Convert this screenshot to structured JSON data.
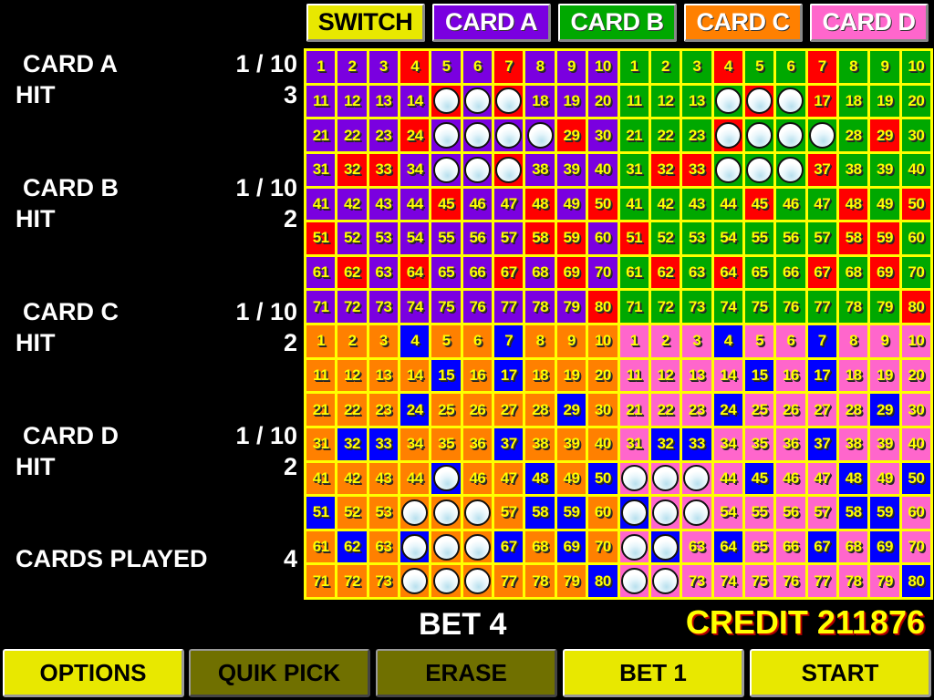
{
  "colors": {
    "card_a": "#7a00e0",
    "card_b": "#00a800",
    "card_c": "#ff8000",
    "card_d": "#ff66cc",
    "drawn_top": "#ff0000",
    "drawn_bottom": "#0000ff",
    "switch": "#e8e800",
    "button_active": "#e8e800",
    "button_disabled": "#707000"
  },
  "tabs": [
    {
      "label": "SWITCH",
      "color": "#e8e800",
      "text": "dark"
    },
    {
      "label": "CARD A",
      "color": "#7a00e0",
      "text": "white"
    },
    {
      "label": "CARD B",
      "color": "#00a800",
      "text": "white"
    },
    {
      "label": "CARD C",
      "color": "#ff8000",
      "text": "white"
    },
    {
      "label": "CARD D",
      "color": "#ff66cc",
      "text": "white"
    }
  ],
  "cards": [
    {
      "name": "CARD A",
      "spots": "1 / 10",
      "hit_label": "HIT",
      "hits": "3",
      "color": "#7a00e0",
      "drawn_color": "#ff0000",
      "picks": [
        15,
        16,
        17,
        25,
        26,
        27,
        28,
        35,
        36,
        37
      ]
    },
    {
      "name": "CARD B",
      "spots": "1 / 10",
      "hit_label": "HIT",
      "hits": "2",
      "color": "#00a800",
      "drawn_color": "#ff0000",
      "picks": [
        14,
        15,
        16,
        24,
        25,
        26,
        27,
        34,
        35,
        36
      ]
    },
    {
      "name": "CARD C",
      "spots": "1 / 10",
      "hit_label": "HIT",
      "hits": "2",
      "color": "#ff8000",
      "drawn_color": "#0000ff",
      "picks": [
        45,
        54,
        55,
        56,
        64,
        65,
        66,
        74,
        75,
        76
      ]
    },
    {
      "name": "CARD D",
      "spots": "1 / 10",
      "hit_label": "HIT",
      "hits": "2",
      "color": "#ff66cc",
      "drawn_color": "#0000ff",
      "picks": [
        41,
        42,
        43,
        51,
        52,
        53,
        61,
        62,
        71,
        72
      ]
    }
  ],
  "drawn_numbers": [
    4,
    7,
    15,
    17,
    24,
    29,
    32,
    33,
    37,
    45,
    48,
    50,
    51,
    58,
    59,
    62,
    64,
    67,
    69,
    80
  ],
  "cards_played": {
    "label": "CARDS PLAYED",
    "value": "4"
  },
  "bet": "BET 4",
  "credit": "CREDIT 211876",
  "buttons": [
    {
      "label": "OPTIONS",
      "enabled": true
    },
    {
      "label": "QUIK PICK",
      "enabled": false
    },
    {
      "label": "ERASE",
      "enabled": false
    },
    {
      "label": "BET 1",
      "enabled": true
    },
    {
      "label": "START",
      "enabled": true
    }
  ]
}
